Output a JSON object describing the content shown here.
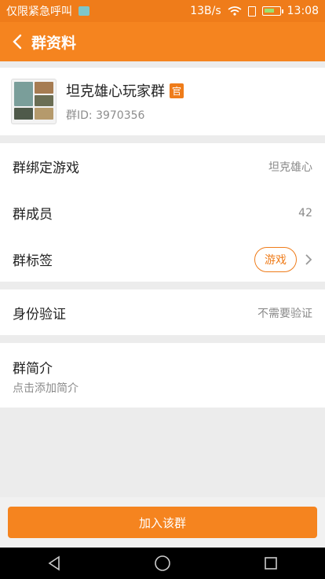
{
  "status_bar": {
    "carrier": "仅限紧急呼叫",
    "speed": "13B/s",
    "time": "13:08"
  },
  "app_bar": {
    "title": "群资料"
  },
  "group": {
    "name": "坦克雄心玩家群",
    "badge": "官",
    "id": "群ID: 3970356"
  },
  "info_rows": {
    "bound_game_label": "群绑定游戏",
    "bound_game_value": "坦克雄心",
    "members_label": "群成员",
    "members_value": "42",
    "tags_label": "群标签",
    "tag_value": "游戏"
  },
  "verification": {
    "label": "身份验证",
    "value": "不需要验证"
  },
  "intro": {
    "title": "群简介",
    "hint": "点击添加简介"
  },
  "join_button": {
    "label": "加入该群"
  },
  "colors": {
    "accent": "#f5841f",
    "status_bar": "#ef7c1a"
  },
  "icons": [
    "back-icon",
    "wifi-icon",
    "sim-icon",
    "battery-icon",
    "chevron-right-icon",
    "nav-back-icon",
    "nav-home-icon",
    "nav-recent-icon"
  ]
}
